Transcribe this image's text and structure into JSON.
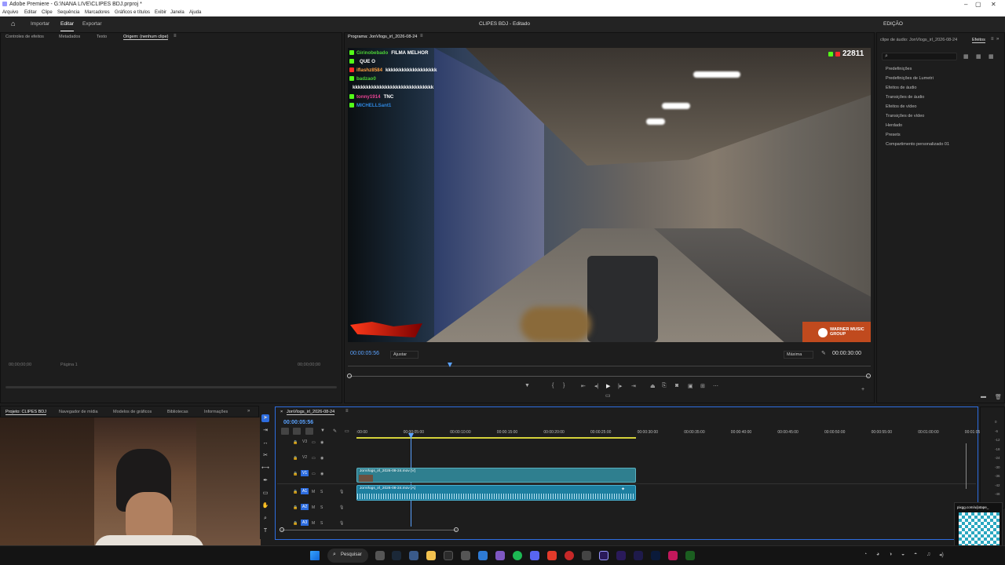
{
  "window": {
    "title": "Adobe Premiere - G:\\NANA LIVE\\CLIPES BDJ.prproj *"
  },
  "menu": [
    "Arquivo",
    "Editar",
    "Clipe",
    "Sequência",
    "Marcadores",
    "Gráficos e títulos",
    "Exibir",
    "Janela",
    "Ajuda"
  ],
  "workspace": {
    "tabs": [
      "Importar",
      "Editar",
      "Exportar"
    ],
    "active": "Editar",
    "center_title": "CLIPES BDJ - Editado",
    "right_label": "EDIÇÃO"
  },
  "source_panel": {
    "tabs": [
      "Controles de efeitos",
      "Metadados",
      "Texto",
      "Origem: (nenhum clipe)"
    ],
    "tc_left": "00;00;00;00",
    "tc_right": "00;00;00;00",
    "page": "Página 1"
  },
  "program": {
    "tab": "Programa: JonVlogs_irl_2026-08-24",
    "timecode": "00:00:05:56",
    "fit": "Ajustar",
    "quality": "Máxima",
    "duration": "00:00:30:00"
  },
  "stream_overlay": {
    "viewer_count": "22811",
    "chat": [
      {
        "user": "Girinobebado",
        "msg": "FILMA MELHOR",
        "color": "#4cd137",
        "platform": "kick"
      },
      {
        "user": "",
        "msg": "QUE O",
        "color": "#ffffff",
        "platform": "kick"
      },
      {
        "user": "iflashz8584",
        "msg": "kkkkkkkkkkkkkkkkkkk",
        "color": "#ff9f43",
        "platform": "yt"
      },
      {
        "user": "badzao0",
        "msg": "",
        "color": "#4cd137",
        "platform": "kick"
      },
      {
        "user": "",
        "msg": "kkkkkkkkkkkkkkkkkkkkkkkkkkkkkk",
        "color": "#ffffff",
        "platform": "none"
      },
      {
        "user": "tonny1914",
        "msg": "TNC",
        "color": "#e84393",
        "platform": "kick"
      },
      {
        "user": "MICHELLSant1",
        "msg": "",
        "color": "#2e86de",
        "platform": "kick"
      }
    ],
    "watermark": "WARNER MUSIC GROUP"
  },
  "effects_panel": {
    "tabs": [
      "clipe de áudio: JonVlogs_irl_2026-08-24",
      "Efeitos"
    ],
    "items": [
      "Predefinições",
      "Predefinições de Lumetri",
      "Efeitos de áudio",
      "Transições de áudio",
      "Efeitos de vídeo",
      "Transições de vídeo",
      "Herdado",
      "Presets",
      "Compartimento personalizado 01"
    ]
  },
  "project_panel": {
    "tabs": [
      "Projeto: CLIPES BDJ",
      "Navegador de mídia",
      "Modelos de gráficos",
      "Bibliotecas",
      "Informações"
    ]
  },
  "timeline": {
    "sequence": "JonVlogs_irl_2026-08-24",
    "timecode": "00:00:05:56",
    "ruler": [
      ":00:00",
      "00:00:05:00",
      "00:00:10:00",
      "00:00:15:00",
      "00:00:20:00",
      "00:00:25:00",
      "00:00:30:00",
      "00:00:35:00",
      "00:00:40:00",
      "00:00:45:00",
      "00:00:50:00",
      "00:00:55:00",
      "00:01:00:00",
      "00:01:05"
    ],
    "tracks": [
      "V3",
      "V2",
      "V1",
      "A1",
      "A2",
      "A3"
    ],
    "video_clip": "JonVlogs_irl_2026-08-24.mov [V]",
    "audio_clip": "JonVlogs_irl_2026-08-24.mov [A]"
  },
  "taskbar": {
    "search": "Pesquisar"
  },
  "qr": {
    "caption": "pixgg.com/u/jotape_",
    "sub": "DÁ AQUI A MORAL"
  }
}
